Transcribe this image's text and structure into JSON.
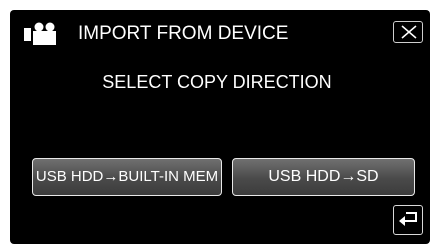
{
  "header": {
    "icon": "video-camera-icon",
    "title": "IMPORT FROM DEVICE",
    "close_icon": "close-icon"
  },
  "prompt": "SELECT COPY DIRECTION",
  "options": [
    {
      "label": "USB HDD→BUILT-IN MEM"
    },
    {
      "label": "USB HDD→SD"
    }
  ],
  "footer": {
    "back_icon": "return-arrow-icon"
  },
  "colors": {
    "background": "#000000",
    "text": "#ffffff",
    "button_top": "#707070",
    "button_bottom": "#3c3c3c"
  }
}
